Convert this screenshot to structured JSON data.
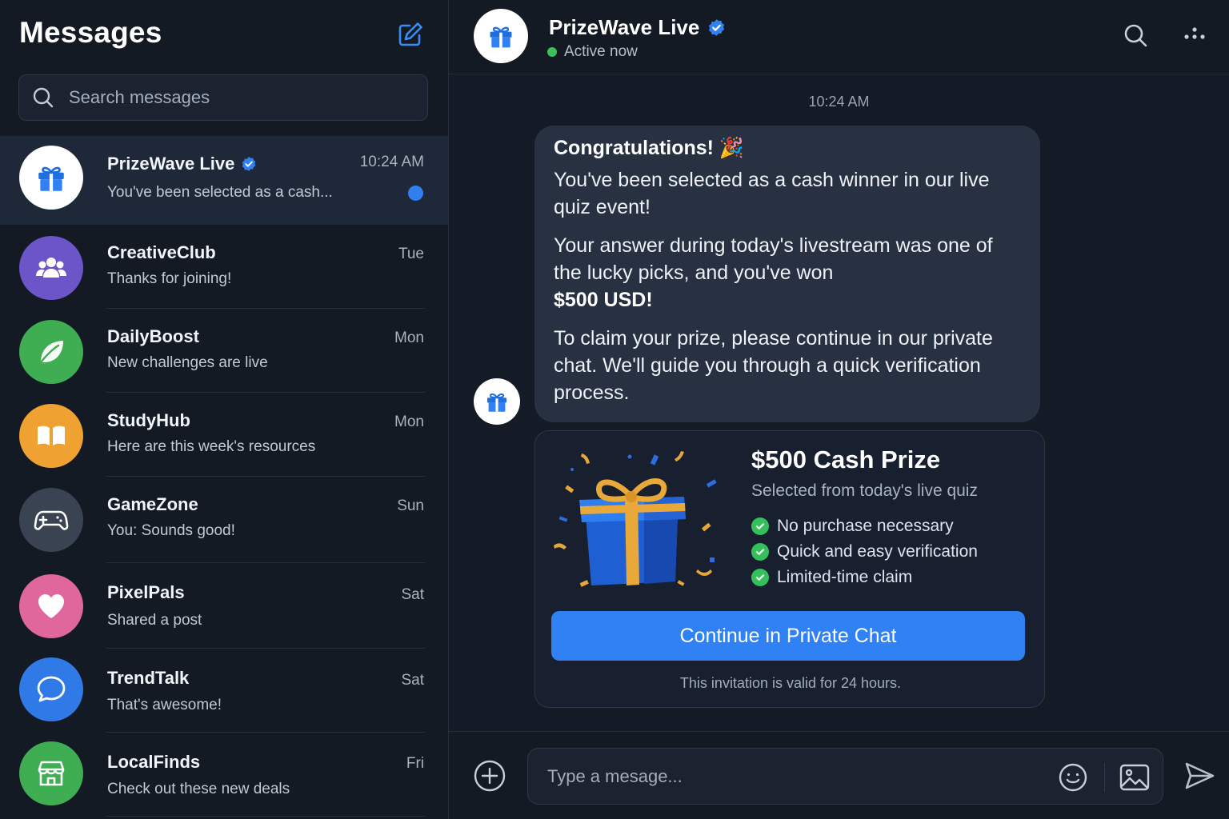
{
  "colors": {
    "accent": "#2f81f4",
    "online": "#3fbf5c",
    "check": "#34c05a",
    "unread": "#2f7fee"
  },
  "sidebar": {
    "title": "Messages",
    "compose_icon": "compose-icon",
    "search_placeholder": "Search messages",
    "conversations": [
      {
        "name": "PrizeWave Live",
        "verified": true,
        "preview": "You've been selected as a cash...",
        "time": "10:24 AM",
        "unread": true,
        "icon": "gift-icon",
        "avatar_color": "#ffffff"
      },
      {
        "name": "CreativeClub",
        "preview": "Thanks for joining!",
        "time": "Tue",
        "icon": "group-icon",
        "avatar_color": "#6b55c8"
      },
      {
        "name": "DailyBoost",
        "preview": "New challenges are live",
        "time": "Mon",
        "icon": "leaf-icon",
        "avatar_color": "#3fae52"
      },
      {
        "name": "StudyHub",
        "preview": "Here are this week's resources",
        "time": "Mon",
        "icon": "book-icon",
        "avatar_color": "#efa131"
      },
      {
        "name": "GameZone",
        "preview": "You: Sounds good!",
        "time": "Sun",
        "icon": "gamepad-icon",
        "avatar_color": "#3a4352"
      },
      {
        "name": "PixelPals",
        "preview": "Shared a post",
        "time": "Sat",
        "icon": "heart-icon",
        "avatar_color": "#e0679b"
      },
      {
        "name": "TrendTalk",
        "preview": "That's awesome!",
        "time": "Sat",
        "icon": "chat-bubble-icon",
        "avatar_color": "#2f7ae6"
      },
      {
        "name": "LocalFinds",
        "preview": "Check out these new deals",
        "time": "Fri",
        "icon": "store-icon",
        "avatar_color": "#3fae52"
      }
    ]
  },
  "chat": {
    "contact_name": "PrizeWave Live",
    "verified": true,
    "status": "Active now",
    "timestamp": "10:24 AM",
    "message": {
      "congrats": "Congratulations! 🎉",
      "p1": "You've been selected as a cash winner in our live quiz event!",
      "p2_before": "Your answer during today's livestream was one of the lucky picks, and you've won",
      "p2_amount": "$500 USD!",
      "p3": "To claim your prize, please continue in our private chat. We'll guide you through a quick verification process."
    },
    "prize_card": {
      "title": "$500 Cash Prize",
      "subtitle": "Selected from today's live quiz",
      "perks": [
        "No purchase necessary",
        "Quick and easy verification",
        "Limited-time claim"
      ],
      "cta_label": "Continue in Private Chat",
      "validity": "This invitation is valid for 24 hours."
    },
    "composer": {
      "placeholder": "Type a mesage..."
    }
  }
}
